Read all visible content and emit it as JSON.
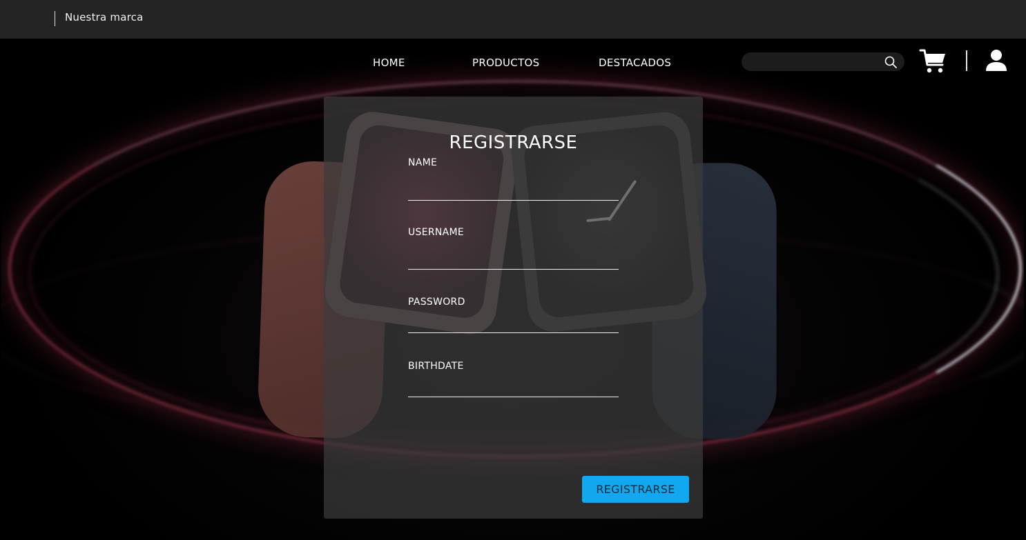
{
  "header": {
    "brand": "Nuestra marca"
  },
  "nav": {
    "home": "HOME",
    "products": "PRODUCTOS",
    "featured": "DESTACADOS"
  },
  "search": {
    "placeholder": "",
    "value": ""
  },
  "icons": {
    "search": "search-icon",
    "cart": "cart-icon",
    "user": "user-icon"
  },
  "form": {
    "title": "REGISTRARSE",
    "fields": [
      {
        "label": "NAME",
        "value": ""
      },
      {
        "label": "USERNAME",
        "value": ""
      },
      {
        "label": "PASSWORD",
        "value": ""
      },
      {
        "label": "BIRTHDATE",
        "value": ""
      }
    ],
    "submit_label": "REGISTRARSE"
  },
  "colors": {
    "topbar": "#242424",
    "panel": "#3c3c3c",
    "accent": "#12a8ef"
  }
}
